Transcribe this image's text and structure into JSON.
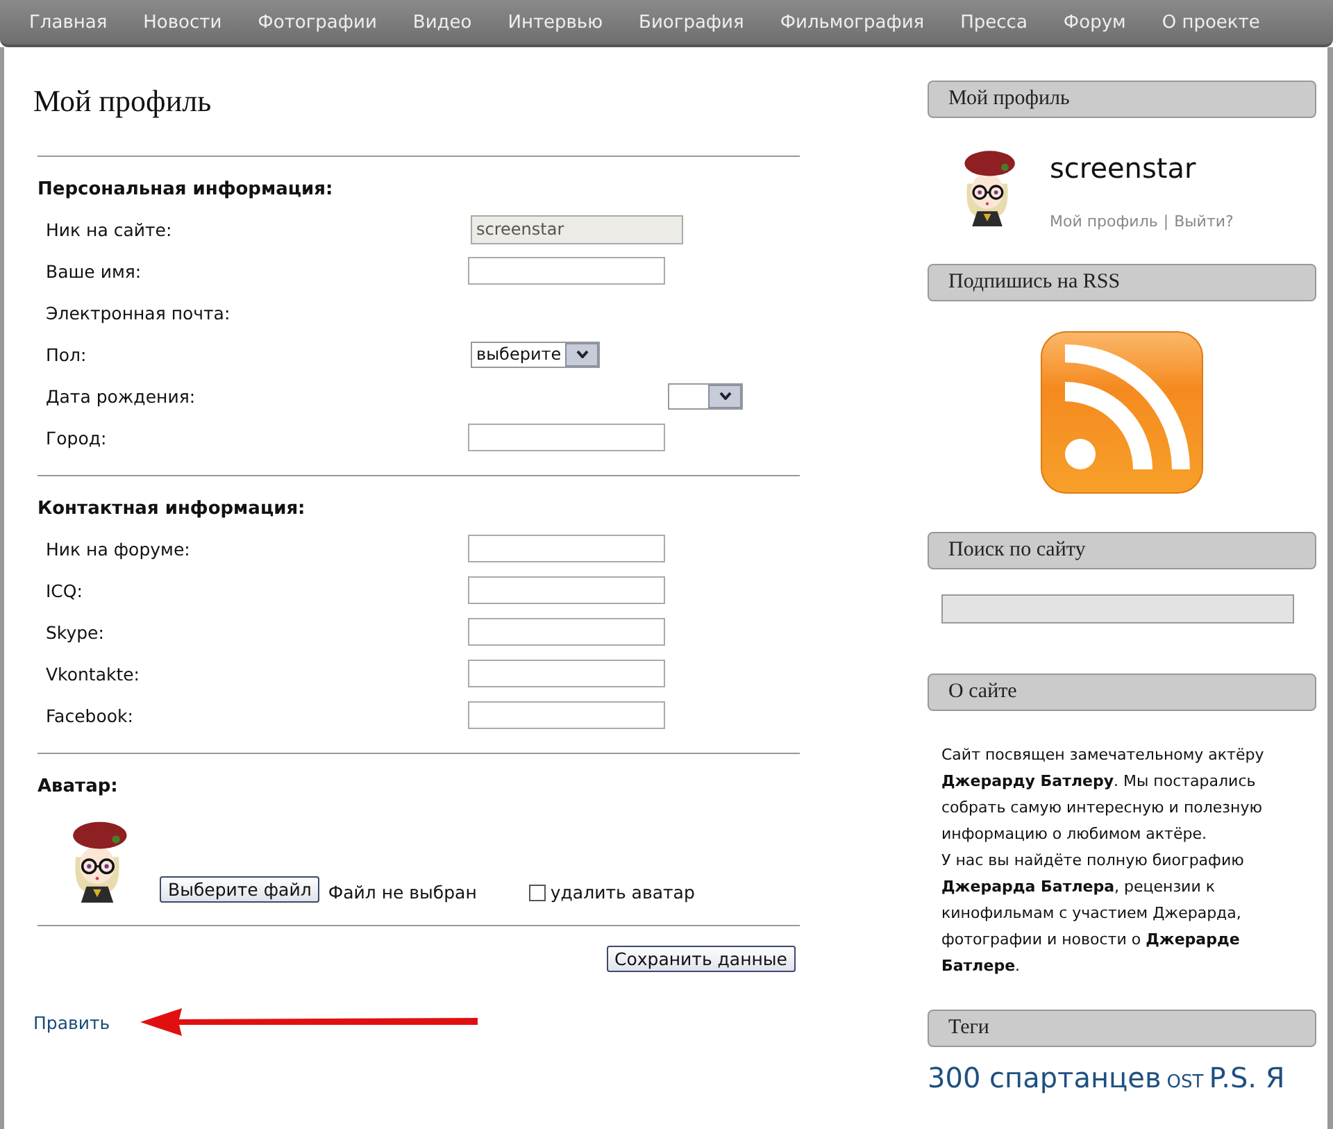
{
  "nav": [
    {
      "label": "Главная"
    },
    {
      "label": "Новости"
    },
    {
      "label": "Фотографии"
    },
    {
      "label": "Видео"
    },
    {
      "label": "Интервью"
    },
    {
      "label": "Биография"
    },
    {
      "label": "Фильмография"
    },
    {
      "label": "Пресса"
    },
    {
      "label": "Форум"
    },
    {
      "label": "О проекте"
    }
  ],
  "profile_form": {
    "title": "Мой профиль",
    "sections": [
      {
        "heading": "Персональная информация:",
        "fields": [
          {
            "label": "Ник на сайте:",
            "kind": "readonly",
            "value": "screenstar"
          },
          {
            "label": "Ваше имя:",
            "kind": "text"
          },
          {
            "label": "Электронная почта:",
            "kind": "none"
          },
          {
            "label": "Пол:",
            "kind": "select",
            "value": "выберите"
          },
          {
            "label": "Дата рождения:",
            "kind": "date"
          },
          {
            "label": "Город:",
            "kind": "text"
          }
        ]
      },
      {
        "heading": "Контактная информация:",
        "fields": [
          {
            "label": "Ник на форуме:",
            "kind": "text"
          },
          {
            "label": "ICQ:",
            "kind": "text"
          },
          {
            "label": "Skype:",
            "kind": "text"
          },
          {
            "label": "Vkontakte:",
            "kind": "text"
          },
          {
            "label": "Facebook:",
            "kind": "text"
          }
        ]
      }
    ],
    "avatar": {
      "heading": "Аватар:",
      "file_button": "Выберите файл",
      "file_status": "Файл не выбран",
      "delete_label": "удалить аватар",
      "delete_checked": false
    },
    "save_button": "Сохранить данные",
    "edit_link": "Править"
  },
  "sidebar": [
    {
      "kind": "profile",
      "title": "Мой профиль",
      "username": "screenstar",
      "links": [
        "Мой профиль",
        "Выйти?"
      ],
      "separator": "|"
    },
    {
      "kind": "rss",
      "title": "Подпишись на RSS"
    },
    {
      "kind": "search",
      "title": "Поиск по сайту"
    },
    {
      "kind": "about",
      "title": "О сайте",
      "paragraphs": [
        "Сайт посвящен замечательному актёру **Джерарду Батлеру**. Мы постарались собрать самую интересную и полезную информацию о любимом актёре.",
        "У нас вы найдёте полную биографию **Джерарда Батлера**, рецензии к кинофильмам с участием Джерарда, фотографии и новости о **Джерарде Батлере**."
      ]
    },
    {
      "kind": "tags",
      "title": "Теги",
      "tags": [
        {
          "label": "300 спартанцев",
          "kind": "large"
        },
        {
          "label": "OST",
          "kind": "small"
        },
        {
          "label": "P.S. Я",
          "kind": "large"
        }
      ]
    }
  ]
}
